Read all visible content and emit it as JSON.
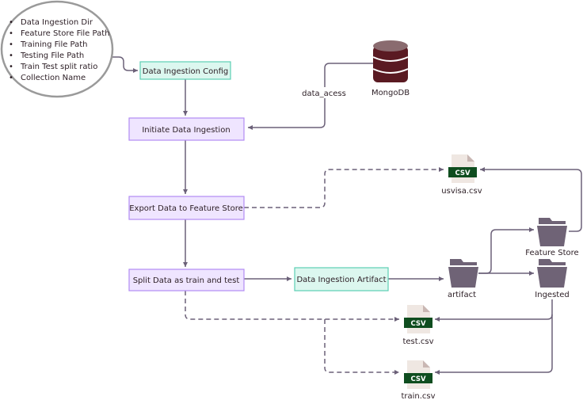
{
  "config_list": {
    "items": [
      "Data Ingestion Dir",
      "Feature Store File Path",
      "Training File Path",
      "Testing File Path",
      "Train Test split ratio",
      "Collection Name"
    ]
  },
  "nodes": {
    "config": "Data Ingestion Config",
    "initiate": "Initiate Data Ingestion",
    "export": "Export Data to Feature Store",
    "split": "Split Data as train and test",
    "artifact_box": "Data Ingestion Artifact"
  },
  "mongodb": {
    "label": "MongoDB",
    "edge_label": "data_acess"
  },
  "files": {
    "usvisa": "usvisa.csv",
    "test": "test.csv",
    "train": "train.csv",
    "badge": "CSV"
  },
  "folders": {
    "artifact": "artifact",
    "feature_store": "Feature Store",
    "ingested": "Ingested"
  },
  "colors": {
    "teal_fill": "#dcf7ef",
    "teal_border": "#5ccfb3",
    "purple_fill": "#efe5ff",
    "purple_border": "#b28bf4",
    "line": "#6b6078",
    "folder": "#6f6376",
    "db": "#5a1a22",
    "csv_badge": "#0f4d1f"
  }
}
